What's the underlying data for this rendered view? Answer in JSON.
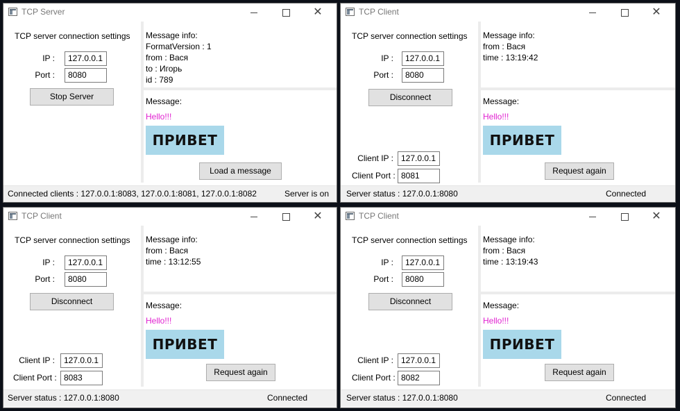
{
  "windows": {
    "server": {
      "title": "TCP Server",
      "settings_title": "TCP server connection settings",
      "ip_label": "IP :",
      "ip_value": "127.0.0.1",
      "port_label": "Port :",
      "port_value": "8080",
      "action_button": "Stop Server",
      "info_title": "Message info:",
      "info_lines": [
        "FormatVersion : 1",
        "from : Вася",
        "to : Игорь",
        "id : 789"
      ],
      "message_title": "Message:",
      "message_text": "Hello!!!",
      "image_text": "ПРИВЕТ",
      "secondary_button": "Load a message",
      "status_left": "Connected clients :  127.0.0.1:8083, 127.0.0.1:8081, 127.0.0.1:8082",
      "status_right": "Server is on"
    },
    "client_a": {
      "title": "TCP Client",
      "settings_title": "TCP server connection settings",
      "ip_label": "IP :",
      "ip_value": "127.0.0.1",
      "port_label": "Port :",
      "port_value": "8080",
      "action_button": "Disconnect",
      "client_ip_label": "Client IP :",
      "client_ip_value": "127.0.0.1",
      "client_port_label": "Client Port :",
      "client_port_value": "8081",
      "info_title": "Message info:",
      "info_lines": [
        "from : Вася",
        "time : 13:19:42"
      ],
      "message_title": "Message:",
      "message_text": "Hello!!!",
      "image_text": "ПРИВЕТ",
      "secondary_button": "Request again",
      "status_left": "Server status :  127.0.0.1:8080",
      "status_right": "Connected"
    },
    "client_b": {
      "title": "TCP Client",
      "settings_title": "TCP server connection settings",
      "ip_label": "IP :",
      "ip_value": "127.0.0.1",
      "port_label": "Port :",
      "port_value": "8080",
      "action_button": "Disconnect",
      "client_ip_label": "Client IP :",
      "client_ip_value": "127.0.0.1",
      "client_port_label": "Client Port :",
      "client_port_value": "8083",
      "info_title": "Message info:",
      "info_lines": [
        "from : Вася",
        "time : 13:12:55"
      ],
      "message_title": "Message:",
      "message_text": "Hello!!!",
      "image_text": "ПРИВЕТ",
      "secondary_button": "Request again",
      "status_left": "Server status :  127.0.0.1:8080",
      "status_right": "Connected"
    },
    "client_c": {
      "title": "TCP Client",
      "settings_title": "TCP server connection settings",
      "ip_label": "IP :",
      "ip_value": "127.0.0.1",
      "port_label": "Port :",
      "port_value": "8080",
      "action_button": "Disconnect",
      "client_ip_label": "Client IP :",
      "client_ip_value": "127.0.0.1",
      "client_port_label": "Client Port :",
      "client_port_value": "8082",
      "info_title": "Message info:",
      "info_lines": [
        "from : Вася",
        "time : 13:19:43"
      ],
      "message_title": "Message:",
      "message_text": "Hello!!!",
      "image_text": "ПРИВЕТ",
      "secondary_button": "Request again",
      "status_left": "Server status :  127.0.0.1:8080",
      "status_right": "Connected"
    }
  },
  "colors": {
    "message_text": "#e020d0",
    "image_background": "#a9d8ea",
    "status_bar": "#f0f0f0",
    "desktop": "#0c1018"
  },
  "icons": {
    "app": "app-window-icon",
    "minimize": "minimize-icon",
    "maximize": "maximize-icon",
    "close": "close-icon"
  }
}
